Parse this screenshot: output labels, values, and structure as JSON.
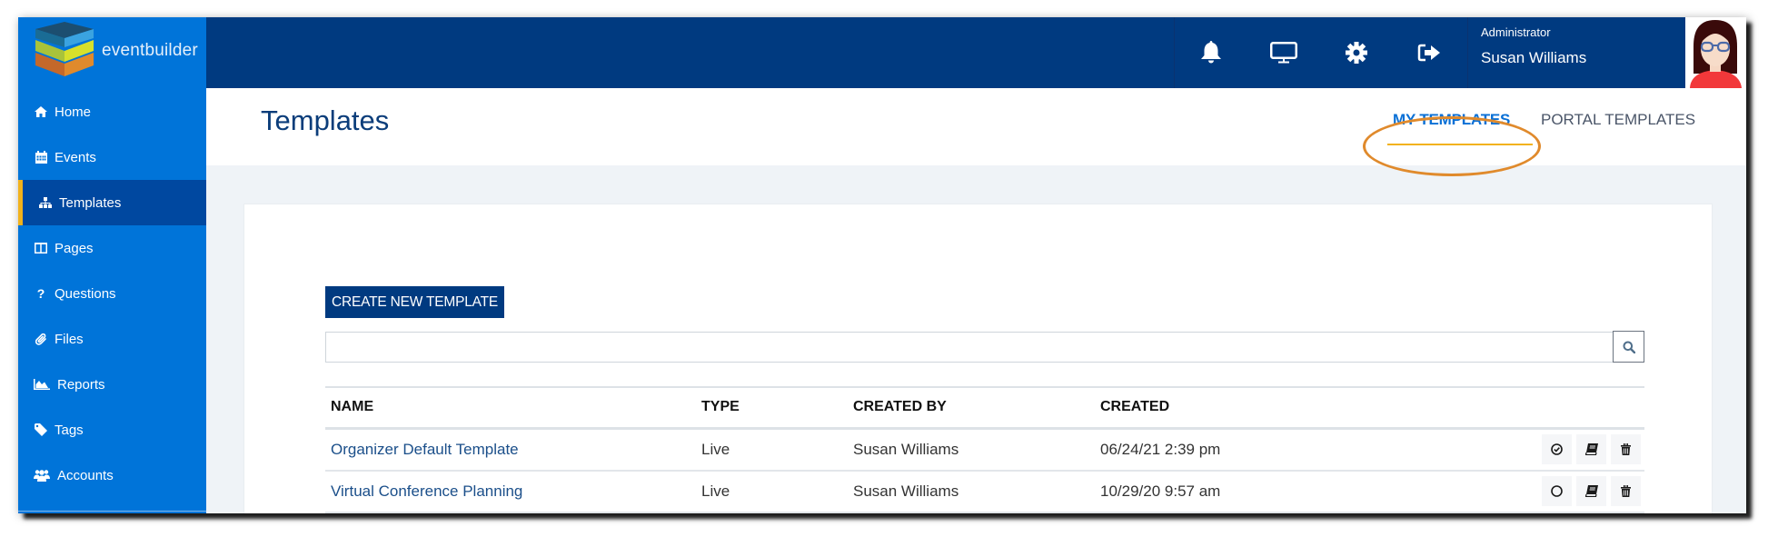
{
  "app": {
    "brand": "eventbuilder"
  },
  "sidebar": {
    "items": [
      {
        "label": "Home",
        "icon": "home-icon"
      },
      {
        "label": "Events",
        "icon": "calendar-icon"
      },
      {
        "label": "Templates",
        "icon": "sitemap-icon",
        "active": true
      },
      {
        "label": "Pages",
        "icon": "columns-icon"
      },
      {
        "label": "Questions",
        "icon": "question-icon"
      },
      {
        "label": "Files",
        "icon": "paperclip-icon"
      },
      {
        "label": "Reports",
        "icon": "area-chart-icon"
      },
      {
        "label": "Tags",
        "icon": "tag-icon"
      },
      {
        "label": "Accounts",
        "icon": "users-icon"
      }
    ]
  },
  "header": {
    "icons": [
      "bell-icon",
      "monitor-icon",
      "gear-icon",
      "sign-out-icon"
    ],
    "user": {
      "role": "Administrator",
      "name": "Susan Williams"
    }
  },
  "page": {
    "title": "Templates",
    "tabs": [
      {
        "label": "MY TEMPLATES",
        "active": true
      },
      {
        "label": "PORTAL TEMPLATES",
        "active": false
      }
    ]
  },
  "toolbar": {
    "create_label": "CREATE NEW TEMPLATE",
    "search_value": "",
    "search_placeholder": ""
  },
  "table": {
    "columns": [
      "NAME",
      "TYPE",
      "CREATED BY",
      "CREATED"
    ],
    "rows": [
      {
        "name": "Organizer Default Template",
        "type": "Live",
        "created_by": "Susan Williams",
        "created": "06/24/21 2:39 pm",
        "default": true
      },
      {
        "name": "Virtual Conference Planning",
        "type": "Live",
        "created_by": "Susan Williams",
        "created": "10/29/20 9:57 am",
        "default": false
      }
    ]
  },
  "colors": {
    "sidebar": "#0074d9",
    "sidebar_active": "#0048a0",
    "header": "#003a80",
    "accent": "#f2b21b",
    "annotation": "#e08a2c",
    "link": "#1b4f8a"
  }
}
